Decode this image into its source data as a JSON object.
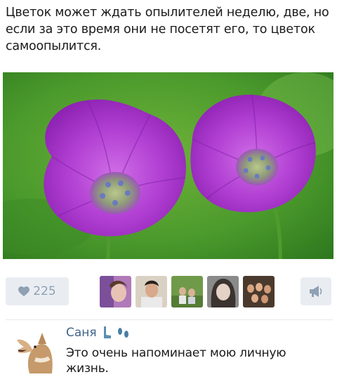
{
  "post": {
    "text": "Цветок может ждать опылителей неделю, две, но если за это время они не посетят его, то цветок самоопылится."
  },
  "actions": {
    "like_count": "225"
  },
  "comment": {
    "author": "Саня",
    "text": "Это очень напоминает мою личную жизнь."
  },
  "colors": {
    "button_bg": "#e9edf2",
    "icon_gray": "#8fa1b3",
    "link_blue": "#42648b",
    "flower_purple": "#a531c9"
  },
  "icons": {
    "like": "heart-icon",
    "share": "megaphone-icon",
    "author_emoji_1": "leg-emoji-icon",
    "author_emoji_2": "footprints-emoji-icon"
  }
}
